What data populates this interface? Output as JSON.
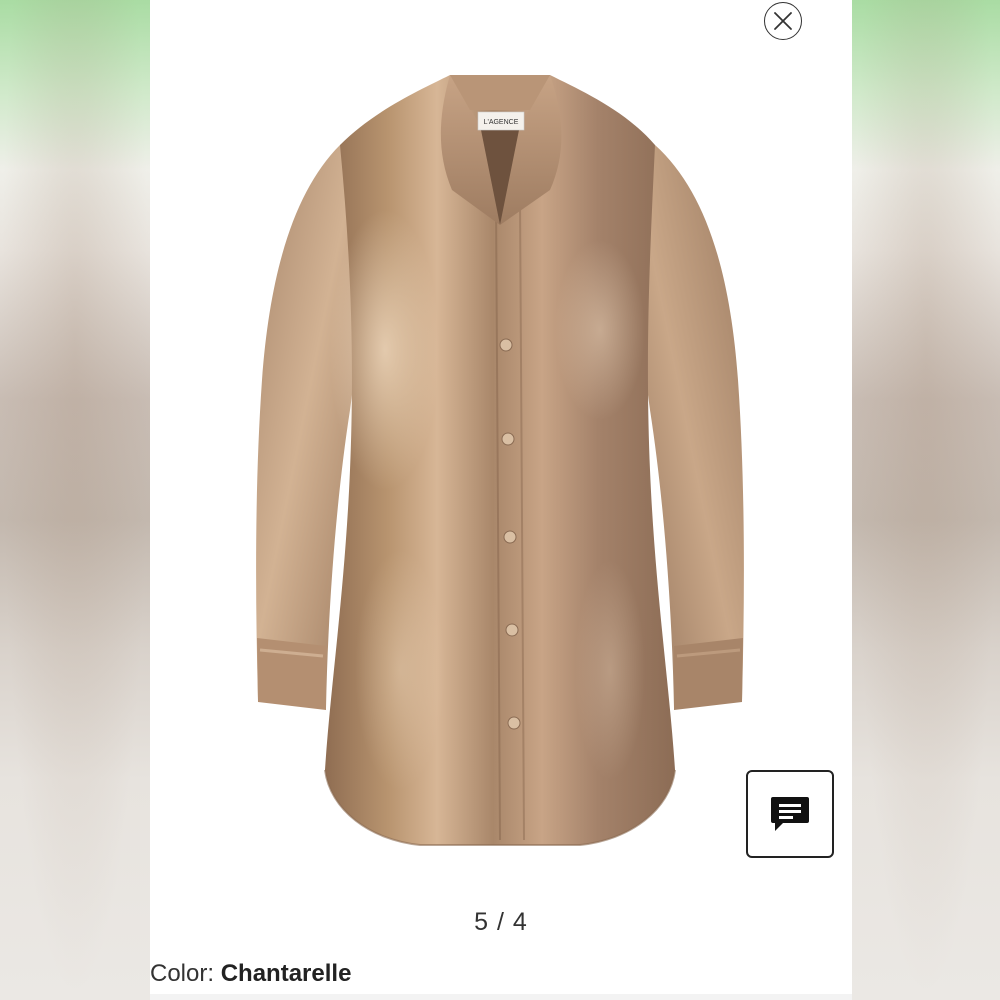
{
  "product": {
    "label_brand": "L'AGENCE",
    "color_label": "Color:",
    "color_value": "Chantarelle"
  },
  "gallery": {
    "pager_text": "5 / 4"
  },
  "icons": {
    "close": "close-icon",
    "chat": "chat-icon"
  },
  "colors": {
    "shirt": "#b08c6c",
    "panel_bg": "#ffffff",
    "text": "#333333"
  }
}
